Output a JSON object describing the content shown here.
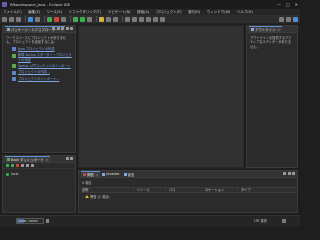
{
  "window": {
    "title": "ENworkspace_java - Eclipse IDE",
    "controls": [
      "—",
      "□",
      "✕"
    ]
  },
  "menu": [
    "ファイル(F)",
    "編集(E)",
    "ソース(S)",
    "リファクタリング(T)",
    "ナビゲート(N)",
    "検索(A)",
    "プロジェクト(P)",
    "実行(R)",
    "ウィンドウ(W)",
    "ヘルプ(H)"
  ],
  "explorer": {
    "tab_label": "パッケージ・エクスプローラー",
    "intro": "ワークスペースにプロジェクトがありません。プロジェクトを追加するには:",
    "links": [
      "Java プロジェクトの作成",
      "新規 Spring スターター・プロジェクトの作成",
      "Spring 入門コンテンツのインポート",
      "プロジェクトの作成...",
      "プロジェクトのインポート..."
    ]
  },
  "outline": {
    "tab_label": "アウトライン",
    "message": "アウトラインを提供するアクティブなエディターがありません。"
  },
  "boot": {
    "tab_label": "Boot ダッシュボード",
    "item": "local"
  },
  "problems": {
    "tabs": [
      "問題",
      "Javadoc",
      "宣言"
    ],
    "summary": "0 項目",
    "columns": [
      "説明",
      "リソース",
      "パス",
      "ロケーション",
      "タイプ"
    ],
    "row": "警告 (1 項目)"
  },
  "status": {
    "memory": "209M / 800M",
    "memory_fraction": 0.26,
    "language": "LTR 選択"
  },
  "colors": {
    "accent": "#5b8fd6",
    "link": "#7fa7e6",
    "run_green": "#3fae4f",
    "warning": "#e2b93b"
  }
}
